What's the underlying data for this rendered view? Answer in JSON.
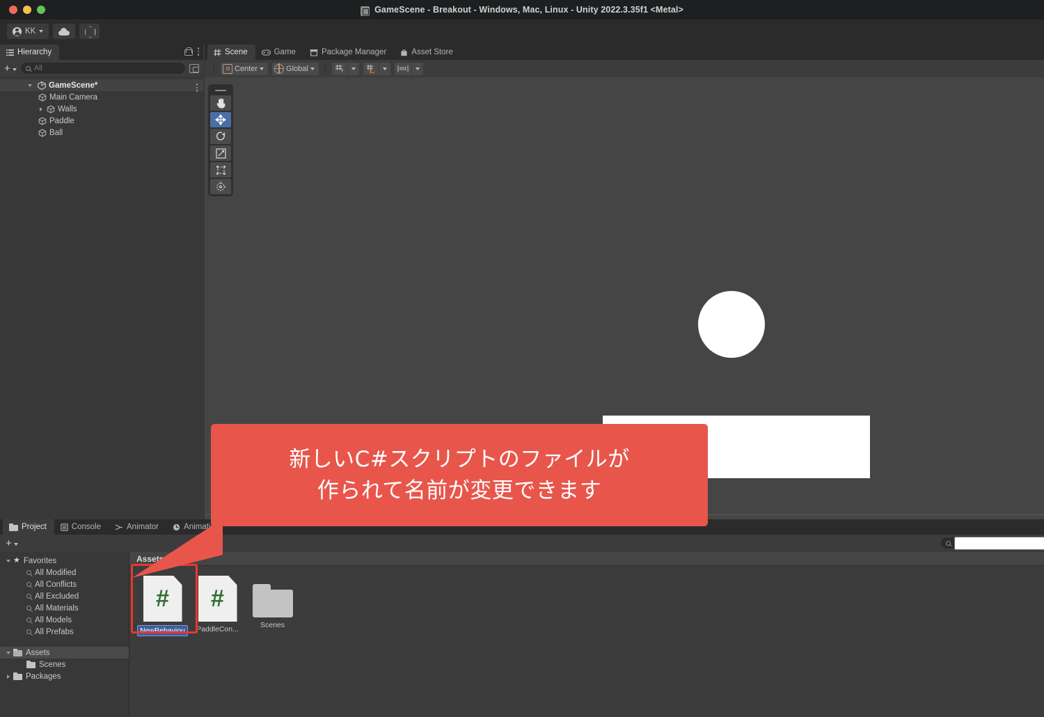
{
  "window": {
    "title": "GameScene - Breakout - Windows, Mac, Linux - Unity 2022.3.35f1 <Metal>",
    "traffic_lights": [
      "close",
      "minimize",
      "maximize"
    ]
  },
  "toolbar": {
    "account_label": "KK",
    "cloud_icon": "cloud-icon",
    "services_icon": "unity-services-icon",
    "play_label": "▶",
    "pause_label": "❚❚",
    "step_label": "▶❚"
  },
  "hierarchy": {
    "tab_label": "Hierarchy",
    "search_placeholder": "All",
    "search_value": "",
    "add_label": "+",
    "items": [
      {
        "label": "GameScene*",
        "depth": 0,
        "icon": "unity-scene-icon",
        "expanded": true,
        "has_arrow": true
      },
      {
        "label": "Main Camera",
        "depth": 1,
        "icon": "gameobject-cube-icon",
        "expanded": false,
        "has_arrow": false
      },
      {
        "label": "Walls",
        "depth": 1,
        "icon": "gameobject-cube-icon",
        "expanded": false,
        "has_arrow": true
      },
      {
        "label": "Paddle",
        "depth": 1,
        "icon": "gameobject-cube-icon",
        "expanded": false,
        "has_arrow": false
      },
      {
        "label": "Ball",
        "depth": 1,
        "icon": "gameobject-cube-icon",
        "expanded": false,
        "has_arrow": false
      }
    ]
  },
  "scene_tabs": [
    {
      "label": "Scene",
      "icon": "scene-grid-icon",
      "active": true
    },
    {
      "label": "Game",
      "icon": "gamepad-icon",
      "active": false
    },
    {
      "label": "Package Manager",
      "icon": "package-icon",
      "active": false
    },
    {
      "label": "Asset Store",
      "icon": "store-bag-icon",
      "active": false
    }
  ],
  "scene_toolbar": {
    "pivot_mode": "Center",
    "handle_space": "Global",
    "grid_axis_icon": "grid-axis-y-icon",
    "grid_snap_icon": "grid-snap-icon",
    "layout_icon": "snap-increment-icon"
  },
  "tool_palette": [
    {
      "name": "hand-tool",
      "icon": "hand-icon",
      "selected": false
    },
    {
      "name": "move-tool",
      "icon": "move-arrows-icon",
      "selected": true
    },
    {
      "name": "rotate-tool",
      "icon": "rotate-icon",
      "selected": false
    },
    {
      "name": "scale-tool",
      "icon": "scale-icon",
      "selected": false
    },
    {
      "name": "rect-transform-tool",
      "icon": "rect-transform-icon",
      "selected": false
    },
    {
      "name": "transform-tool",
      "icon": "transform-globe-icon",
      "selected": false
    }
  ],
  "scene_objects": [
    {
      "name": "ball",
      "shape": "circle",
      "color": "#ffffff"
    },
    {
      "name": "paddle",
      "shape": "rectangle",
      "color": "#ffffff"
    }
  ],
  "callout": {
    "line1": "新しいC#スクリプトのファイルが",
    "line2": "作られて名前が変更できます",
    "color": "#e8564b"
  },
  "project_tabs": [
    {
      "label": "Project",
      "icon": "folder-icon",
      "active": true
    },
    {
      "label": "Console",
      "icon": "console-icon",
      "active": false
    },
    {
      "label": "Animator",
      "icon": "animator-icon",
      "active": false
    },
    {
      "label": "Animation",
      "icon": "animation-clock-icon",
      "active": false
    }
  ],
  "project": {
    "add_label": "+",
    "search_placeholder": "",
    "search_value": "",
    "breadcrumb": "Assets",
    "tree": [
      {
        "label": "Favorites",
        "depth": 0,
        "icon": "star-icon",
        "arrow": "open",
        "selected": false
      },
      {
        "label": "All Modified",
        "depth": 1,
        "icon": "search-icon",
        "arrow": "none",
        "selected": false
      },
      {
        "label": "All Conflicts",
        "depth": 1,
        "icon": "search-icon",
        "arrow": "none",
        "selected": false
      },
      {
        "label": "All Excluded",
        "depth": 1,
        "icon": "search-icon",
        "arrow": "none",
        "selected": false
      },
      {
        "label": "All Materials",
        "depth": 1,
        "icon": "search-icon",
        "arrow": "none",
        "selected": false
      },
      {
        "label": "All Models",
        "depth": 1,
        "icon": "search-icon",
        "arrow": "none",
        "selected": false
      },
      {
        "label": "All Prefabs",
        "depth": 1,
        "icon": "search-icon",
        "arrow": "none",
        "selected": false
      },
      {
        "label": "Assets",
        "depth": 0,
        "icon": "folder-icon",
        "arrow": "open",
        "selected": true
      },
      {
        "label": "Scenes",
        "depth": 1,
        "icon": "folder-icon",
        "arrow": "none",
        "selected": false
      },
      {
        "label": "Packages",
        "depth": 0,
        "icon": "folder-icon",
        "arrow": "closed",
        "selected": false
      }
    ],
    "assets": [
      {
        "label": "NewBehaviou",
        "type": "csharp-script",
        "renaming": true,
        "highlighted": true
      },
      {
        "label": "PaddleCon...",
        "type": "csharp-script",
        "renaming": false,
        "highlighted": false
      },
      {
        "label": "Scenes",
        "type": "folder",
        "renaming": false,
        "highlighted": false
      }
    ],
    "highlight_color": "#e8382d"
  }
}
